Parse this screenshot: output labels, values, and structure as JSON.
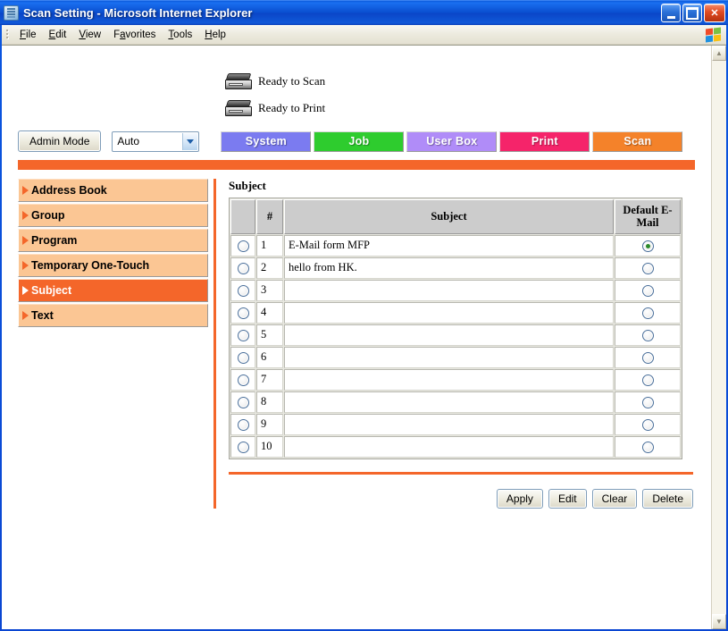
{
  "window": {
    "title": "Scan Setting - Microsoft Internet Explorer",
    "icon": "page-icon",
    "minimize_label": "Minimize",
    "maximize_label": "Maximize",
    "close_label": "✕"
  },
  "menu": {
    "items": [
      {
        "label": "File",
        "accel": "F"
      },
      {
        "label": "Edit",
        "accel": "E"
      },
      {
        "label": "View",
        "accel": "V"
      },
      {
        "label": "Favorites",
        "accel": "a"
      },
      {
        "label": "Tools",
        "accel": "T"
      },
      {
        "label": "Help",
        "accel": "H"
      }
    ]
  },
  "status": {
    "scan": "Ready to Scan",
    "print": "Ready to Print"
  },
  "toolbar": {
    "admin_mode": "Admin Mode",
    "language_value": "Auto",
    "language_options": [
      "Auto"
    ]
  },
  "tabs": [
    {
      "label": "System",
      "color": "#7b7bf0",
      "active": false
    },
    {
      "label": "Job",
      "color": "#2ecc2e",
      "active": false
    },
    {
      "label": "User Box",
      "color": "#b08cf8",
      "active": false
    },
    {
      "label": "Print",
      "color": "#f5246a",
      "active": false
    },
    {
      "label": "Scan",
      "color": "#f4822a",
      "active": true
    }
  ],
  "sidebar": {
    "items": [
      {
        "label": "Address Book",
        "active": false
      },
      {
        "label": "Group",
        "active": false
      },
      {
        "label": "Program",
        "active": false
      },
      {
        "label": "Temporary One-Touch",
        "active": false
      },
      {
        "label": "Subject",
        "active": true
      },
      {
        "label": "Text",
        "active": false
      }
    ]
  },
  "content": {
    "title": "Subject",
    "table": {
      "headers": {
        "select": "",
        "num": "#",
        "subject": "Subject",
        "default_email": "Default E-Mail"
      },
      "rows": [
        {
          "num": "1",
          "subject": "E-Mail form MFP",
          "selected": false,
          "default_email": true
        },
        {
          "num": "2",
          "subject": "hello from HK.",
          "selected": false,
          "default_email": false
        },
        {
          "num": "3",
          "subject": "",
          "selected": false,
          "default_email": false
        },
        {
          "num": "4",
          "subject": "",
          "selected": false,
          "default_email": false
        },
        {
          "num": "5",
          "subject": "",
          "selected": false,
          "default_email": false
        },
        {
          "num": "6",
          "subject": "",
          "selected": false,
          "default_email": false
        },
        {
          "num": "7",
          "subject": "",
          "selected": false,
          "default_email": false
        },
        {
          "num": "8",
          "subject": "",
          "selected": false,
          "default_email": false
        },
        {
          "num": "9",
          "subject": "",
          "selected": false,
          "default_email": false
        },
        {
          "num": "10",
          "subject": "",
          "selected": false,
          "default_email": false
        }
      ]
    },
    "buttons": [
      {
        "label": "Apply"
      },
      {
        "label": "Edit"
      },
      {
        "label": "Clear"
      },
      {
        "label": "Delete"
      }
    ]
  },
  "scrollbar": {
    "up": "▲",
    "down": "▼"
  },
  "colors": {
    "accent_orange": "#f4662a",
    "sidebar_item": "#fbc694",
    "titlebar_blue": "#0a4fd0"
  }
}
